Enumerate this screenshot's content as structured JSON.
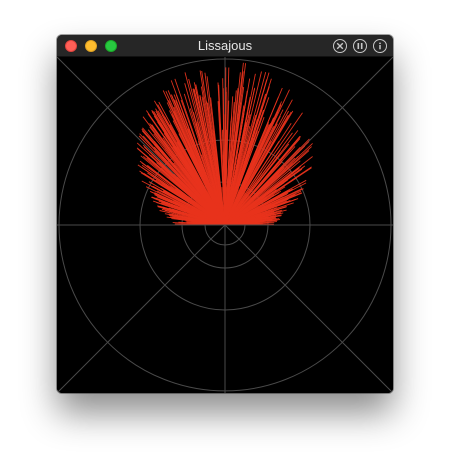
{
  "window": {
    "title": "Lissajous",
    "traffic_lights": [
      {
        "name": "close",
        "color": "#ff5f57"
      },
      {
        "name": "minimize",
        "color": "#febc2e"
      },
      {
        "name": "zoom",
        "color": "#28c840"
      }
    ],
    "toolbar_icons": [
      "close-circle-icon",
      "pause-circle-icon",
      "info-circle-icon"
    ]
  },
  "scope": {
    "background": "#000000",
    "grid_color": "#4a4a4a",
    "trace_color": "#e8331c"
  }
}
